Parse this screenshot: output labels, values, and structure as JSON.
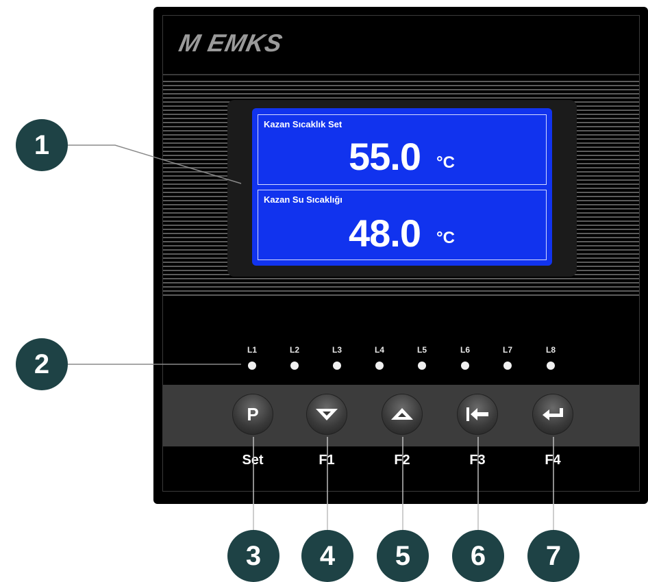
{
  "device": {
    "brand": "EMKS",
    "logo_text": "M EMKS"
  },
  "display": {
    "set": {
      "label": "Kazan Sıcaklık Set",
      "value": "55.0",
      "unit": "°C"
    },
    "water": {
      "label": "Kazan Su Sıcaklığı",
      "value": "48.0",
      "unit": "°C"
    }
  },
  "leds": [
    "L1",
    "L2",
    "L3",
    "L4",
    "L5",
    "L6",
    "L7",
    "L8"
  ],
  "keys": [
    {
      "symbol": "P",
      "label": "Set"
    },
    {
      "symbol": "down",
      "label": "F1"
    },
    {
      "symbol": "up",
      "label": "F2"
    },
    {
      "symbol": "back",
      "label": "F3"
    },
    {
      "symbol": "enter",
      "label": "F4"
    }
  ],
  "callouts": [
    "1",
    "2",
    "3",
    "4",
    "5",
    "6",
    "7"
  ],
  "colors": {
    "lcd": "#1133ee",
    "callout": "#1e4245",
    "device": "#000000"
  }
}
